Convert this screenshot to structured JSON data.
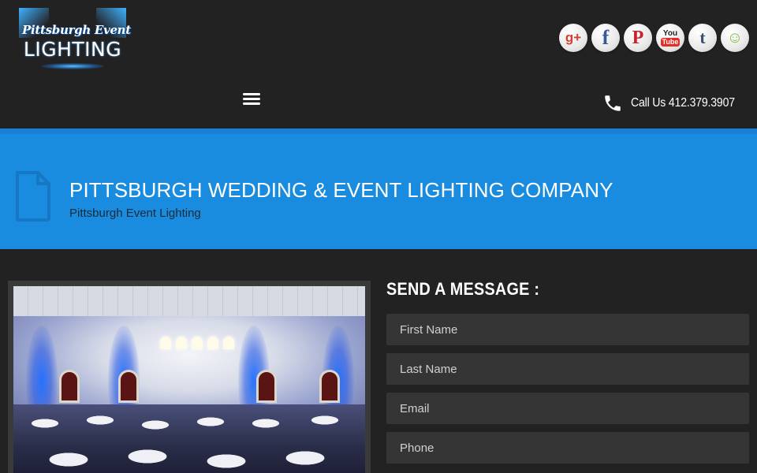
{
  "header": {
    "logo": {
      "line1": "Pittsburgh Event",
      "line2": "LIGHTING"
    },
    "socials": [
      {
        "name": "google-plus",
        "glyph": "g+"
      },
      {
        "name": "facebook",
        "glyph": "f"
      },
      {
        "name": "pinterest",
        "glyph": "P"
      },
      {
        "name": "youtube",
        "glyph_top": "You",
        "glyph_bottom": "Tube"
      },
      {
        "name": "tumblr",
        "glyph": "t"
      },
      {
        "name": "smug",
        "glyph": "☺"
      }
    ],
    "call_label": "Call Us 412.379.3907",
    "colors": {
      "background": "#222223"
    }
  },
  "banner": {
    "title": "PITTSBURGH WEDDING & EVENT LIGHTING COMPANY",
    "subtitle": "Pittsburgh Event Lighting",
    "colors": {
      "background": "#1a8ce0"
    }
  },
  "contact_form": {
    "title": "SEND A MESSAGE :",
    "fields": {
      "first_name": {
        "placeholder": "First Name",
        "value": ""
      },
      "last_name": {
        "placeholder": "Last Name",
        "value": ""
      },
      "email": {
        "placeholder": "Email",
        "value": ""
      },
      "phone": {
        "placeholder": "Phone",
        "value": ""
      }
    }
  }
}
